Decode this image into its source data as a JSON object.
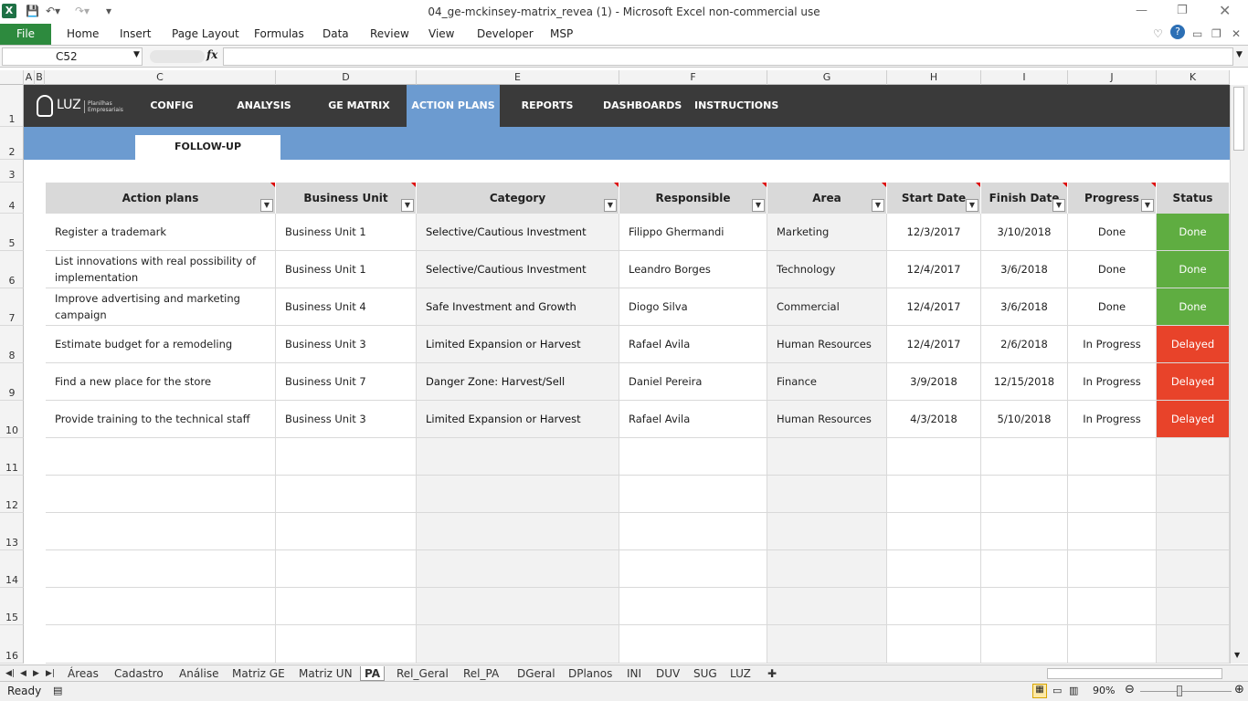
{
  "window": {
    "title": "04_ge-mckinsey-matrix_revea (1)  -  Microsoft Excel non-commercial use"
  },
  "ribbon": {
    "file": "File",
    "tabs": [
      "Home",
      "Insert",
      "Page Layout",
      "Formulas",
      "Data",
      "Review",
      "View",
      "Developer",
      "MSP"
    ]
  },
  "formula_bar": {
    "name_box": "C52",
    "fx": "fx",
    "value": ""
  },
  "columns": [
    "A",
    "B",
    "C",
    "D",
    "E",
    "F",
    "G",
    "H",
    "I",
    "J",
    "K"
  ],
  "rows": [
    "1",
    "2",
    "3",
    "4",
    "5",
    "6",
    "7",
    "8",
    "9",
    "10",
    "11",
    "12",
    "13",
    "14",
    "15",
    "16"
  ],
  "brand": {
    "logo": "LUZ",
    "sub1": "Planilhas",
    "sub2": "Empresariais"
  },
  "nav": [
    "CONFIG",
    "ANALYSIS",
    "GE MATRIX",
    "ACTION PLANS",
    "REPORTS",
    "DASHBOARDS",
    "INSTRUCTIONS"
  ],
  "subtab": "FOLLOW-UP",
  "table": {
    "headers": [
      "Action plans",
      "Business Unit",
      "Category",
      "Responsible",
      "Area",
      "Start Date",
      "Finish Date",
      "Progress",
      "Status"
    ],
    "rows": [
      [
        "Register a trademark",
        "Business Unit 1",
        "Selective/Cautious Investment",
        "Filippo Ghermandi",
        "Marketing",
        "12/3/2017",
        "3/10/2018",
        "Done",
        "Done"
      ],
      [
        "List innovations with real possibility of implementation",
        "Business Unit 1",
        "Selective/Cautious Investment",
        "Leandro Borges",
        "Technology",
        "12/4/2017",
        "3/6/2018",
        "Done",
        "Done"
      ],
      [
        "Improve advertising and marketing campaign",
        "Business Unit 4",
        "Safe Investment and Growth",
        "Diogo Silva",
        "Commercial",
        "12/4/2017",
        "3/6/2018",
        "Done",
        "Done"
      ],
      [
        "Estimate budget for a remodeling",
        "Business Unit 3",
        "Limited Expansion or Harvest",
        "Rafael Avila",
        "Human Resources",
        "12/4/2017",
        "2/6/2018",
        "In Progress",
        "Delayed"
      ],
      [
        "Find a new place for the store",
        "Business Unit 7",
        "Danger Zone: Harvest/Sell",
        "Daniel Pereira",
        "Finance",
        "3/9/2018",
        "12/15/2018",
        "In Progress",
        "Delayed"
      ],
      [
        "Provide training to the technical staff",
        "Business Unit 3",
        "Limited Expansion or Harvest",
        "Rafael Avila",
        "Human Resources",
        "4/3/2018",
        "5/10/2018",
        "In Progress",
        "Delayed"
      ]
    ]
  },
  "sheets": [
    "Áreas",
    "Cadastro",
    "Análise",
    "Matriz GE",
    "Matriz UN",
    "PA",
    "Rel_Geral",
    "Rel_PA",
    "DGeral",
    "DPlanos",
    "INI",
    "DUV",
    "SUG",
    "LUZ"
  ],
  "active_sheet": "PA",
  "status": {
    "ready": "Ready",
    "zoom": "90%"
  },
  "colors": {
    "done": "#5fad41",
    "delayed": "#e8432a",
    "nav": "#3a3a3a",
    "accent": "#6c9bd0"
  }
}
